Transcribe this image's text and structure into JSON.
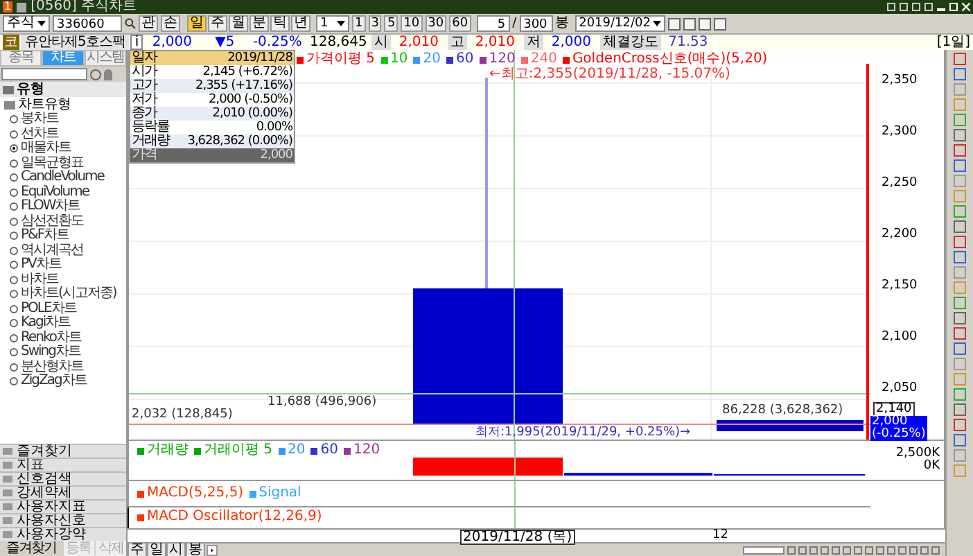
{
  "window": {
    "number": "1",
    "title": "[0560] 주식차트"
  },
  "toolbar": {
    "market": "주식",
    "code": "336060",
    "buttons": [
      "관",
      "손"
    ],
    "periods": [
      {
        "label": "일",
        "selected": true
      },
      {
        "label": "주",
        "selected": false
      },
      {
        "label": "월",
        "selected": false
      },
      {
        "label": "분",
        "selected": false
      },
      {
        "label": "틱",
        "selected": false
      },
      {
        "label": "년",
        "selected": false
      }
    ],
    "interval": "1",
    "quick": [
      "1",
      "3",
      "5",
      "10",
      "30",
      "60"
    ],
    "count": "5",
    "separator": "/",
    "total": "300",
    "unit": "봉",
    "date": "2019/12/02"
  },
  "quote": {
    "badge": "코",
    "name": "유안타제5호스팩",
    "info": "i",
    "price": "2,000",
    "change": "▼5",
    "rate": "-0.25%",
    "volume": "128,645",
    "fields": [
      {
        "label": "시",
        "value": "2,010",
        "color": "#ff0000"
      },
      {
        "label": "고",
        "value": "2,010",
        "color": "#ff0000"
      },
      {
        "label": "저",
        "value": "2,000",
        "color": "#0000ff"
      }
    ],
    "strength_label": "체결강도",
    "strength": "71.53",
    "period": "[1일]"
  },
  "sidebar": {
    "tabs": [
      {
        "label": "종목",
        "selected": false
      },
      {
        "label": "차트",
        "selected": true
      },
      {
        "label": "시스템",
        "selected": false
      }
    ],
    "header": "유형",
    "group": "차트유형",
    "items": [
      {
        "label": "봉차트",
        "selected": false
      },
      {
        "label": "선차트",
        "selected": false
      },
      {
        "label": "매물차트",
        "selected": true
      },
      {
        "label": "일목균형표",
        "selected": false
      },
      {
        "label": "CandleVolume",
        "selected": false
      },
      {
        "label": "EquiVolume",
        "selected": false
      },
      {
        "label": "FLOW차트",
        "selected": false
      },
      {
        "label": "삼선전환도",
        "selected": false
      },
      {
        "label": "P&F차트",
        "selected": false
      },
      {
        "label": "역시계곡선",
        "selected": false
      },
      {
        "label": "PV차트",
        "selected": false
      },
      {
        "label": "바차트",
        "selected": false
      },
      {
        "label": "바차트(시고저종)",
        "selected": false
      },
      {
        "label": "POLE차트",
        "selected": false
      },
      {
        "label": "Kagi차트",
        "selected": false
      },
      {
        "label": "Renko차트",
        "selected": false
      },
      {
        "label": "Swing차트",
        "selected": false
      },
      {
        "label": "분산형차트",
        "selected": false
      },
      {
        "label": "ZigZag차트",
        "selected": false
      }
    ],
    "folders": [
      "즐겨찾기",
      "지표",
      "신호검색",
      "강세약세",
      "사용자지표",
      "사용자신호",
      "사용자강약"
    ],
    "buttons": [
      "즐겨찾기",
      "등록",
      "삭제"
    ]
  },
  "info_box": [
    {
      "label": "일자",
      "value": "2019/11/28"
    },
    {
      "label": "시가",
      "value": "2,145 (+6.72%)"
    },
    {
      "label": "고가",
      "value": "2,355 (+17.16%)"
    },
    {
      "label": "저가",
      "value": "2,000 (-0.50%)"
    },
    {
      "label": "종가",
      "value": "2,010 (0.00%)"
    },
    {
      "label": "등락률",
      "value": "0.00%"
    },
    {
      "label": "거래량",
      "value": "3,628,362 (0.00%)"
    },
    {
      "label": "가격",
      "value": "2,000"
    }
  ],
  "price_legend": [
    {
      "label": "가격이평 5",
      "color": "#ff0000"
    },
    {
      "label": "10",
      "color": "#00cc00"
    },
    {
      "label": "20",
      "color": "#3399ff"
    },
    {
      "label": "60",
      "color": "#3333cc"
    },
    {
      "label": "120",
      "color": "#993399"
    },
    {
      "label": "240",
      "color": "#ff6666"
    },
    {
      "label": "GoldenCross신호(매수)(5,20)",
      "color": "#ff0000"
    }
  ],
  "annotations": {
    "high": "←최고:2,355(2019/11/28, -15.07%)",
    "low": "최저:1,995(2019/11/29, +0.25%)→",
    "volume_left": "11,688 (496,906)",
    "volume_left2": "2,032 (128,845)",
    "volume_right": "86,228 (3,628,362)"
  },
  "price_axis": [
    "2,350",
    "2,300",
    "2,250",
    "2,200",
    "2,150",
    "2,100",
    "2,050"
  ],
  "cross_price": "2,140",
  "current_price": "2,000",
  "current_rate": "(-0.25%)",
  "volume_legend": [
    {
      "label": "거래량",
      "color": "#00aa00"
    },
    {
      "label": "거래이평 5",
      "color": "#00aa00"
    },
    {
      "label": "20",
      "color": "#3399ff"
    },
    {
      "label": "60",
      "color": "#3333cc"
    },
    {
      "label": "120",
      "color": "#993399"
    }
  ],
  "volume_axis": [
    "2,500K",
    "0K"
  ],
  "macd_legend": [
    {
      "label": "MACD(5,25,5)",
      "color": "#ff3300"
    },
    {
      "label": "Signal",
      "color": "#33aaff"
    }
  ],
  "osc_legend": [
    {
      "label": "MACD Oscillator(12,26,9)",
      "color": "#ff3300"
    }
  ],
  "date_axis": {
    "cursor": "2019/11/28 (목)",
    "tick": "12"
  },
  "bottom_tabs": [
    {
      "label": "주",
      "selected": false
    },
    {
      "label": "일",
      "selected": false
    },
    {
      "label": "시",
      "selected": false
    },
    {
      "label": "봉",
      "selected": false
    }
  ]
}
